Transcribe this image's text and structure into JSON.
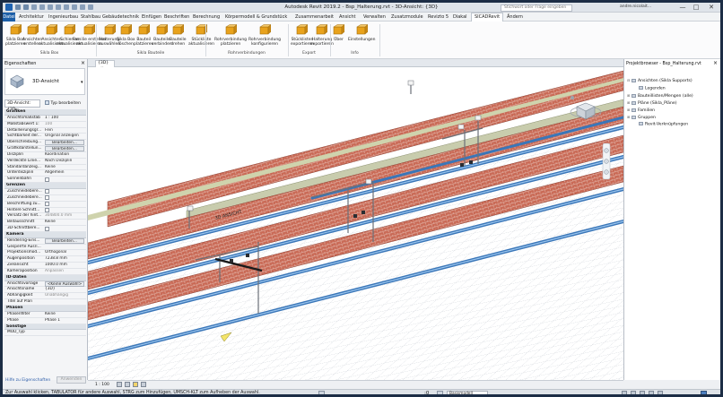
{
  "window": {
    "title": "Autodesk Revit 2019.2 - Bsp_Halterung.rvt - 3D-Ansicht: {3D}",
    "search_placeholder": "Stichwort oder Frage eingeben",
    "user": "andre.nicolait...",
    "minimize": "—",
    "maximize": "□",
    "close": "✕"
  },
  "menu": {
    "file": "Datei",
    "items": [
      "Architektur",
      "Ingenieurbau",
      "Stahlbau",
      "Gebäudetechnik",
      "Einfügen",
      "Beschriften",
      "Berechnung",
      "Körpermodell & Grundstück",
      "Zusammenarbeit",
      "Ansicht",
      "Verwalten",
      "Zusatzmodule",
      "Revizto 5",
      "Diakal",
      "SICADRevit",
      "Ändern"
    ],
    "active": "SICADRevit"
  },
  "ribbon": {
    "buttons": [
      {
        "label": "Sikla Box\nplatzieren",
        "icon": "sikla-box-place-icon",
        "color": "#e8a21c"
      },
      {
        "label": "Ansichten\nerstellen",
        "icon": "views-create-icon",
        "color": "#e8a21c"
      },
      {
        "label": "Ansichten\naktualisieren",
        "icon": "views-update-icon",
        "color": "#e8a21c"
      },
      {
        "label": "Schienen\naktualisieren",
        "icon": "rails-update-icon",
        "color": "#e8a21c"
      },
      {
        "label": "Familie erstellen\naktualisieren",
        "icon": "family-create-icon",
        "color": "#e8a21c"
      },
      {
        "label": "Halterung\nauswählen",
        "icon": "support-select-icon",
        "color": "#e8a21c"
      },
      {
        "label": "Sikla Box\nlöschen",
        "icon": "sikla-box-delete-icon",
        "color": "#e8a21c"
      },
      {
        "label": "Bauteil\nplatzieren",
        "icon": "component-place-icon",
        "color": "#e8a21c"
      },
      {
        "label": "Bauteile\nverbinden",
        "icon": "components-connect-icon",
        "color": "#e8a21c"
      },
      {
        "label": "Bauteile\ndrehen",
        "icon": "components-rotate-icon",
        "color": "#e8a21c"
      },
      {
        "label": "Stückliste\naktualisieren",
        "icon": "bom-update-icon",
        "color": "#e8a21c"
      },
      {
        "label": "Rohrverbindung\nplatzieren",
        "icon": "pipe-connection-place-icon",
        "color": "#e8a21c"
      },
      {
        "label": "Rohrverbindung\nkonfigurieren",
        "icon": "pipe-connection-config-icon",
        "color": "#e8a21c"
      },
      {
        "label": "Stücklisten\nexportieren",
        "icon": "bom-export-icon",
        "color": "#e8a21c"
      },
      {
        "label": "Halterung\nexportieren",
        "icon": "support-export-icon",
        "color": "#e8a21c"
      },
      {
        "label": "Über",
        "icon": "info-icon",
        "color": "#e8a21c"
      },
      {
        "label": "Einstellungen",
        "icon": "settings-icon",
        "color": "#e8a21c"
      }
    ],
    "groups": [
      "Sikla Box",
      "Sikla Bauteile",
      "Rohrverbindungen",
      "Export",
      "Info"
    ]
  },
  "properties": {
    "title": "Eigenschaften",
    "type_name": "3D-Ansicht",
    "filter": "3D-Ansicht: {3D",
    "edit_type": "Typ bearbeiten",
    "sections": [
      {
        "name": "Grafiken",
        "rows": [
          {
            "n": "Ansichtsmaßstab",
            "v": "1 : 100",
            "k": "text"
          },
          {
            "n": "Maßstabswert 1:",
            "v": "100",
            "k": "grey"
          },
          {
            "n": "Detaillierungsgr...",
            "v": "Fein",
            "k": "text"
          },
          {
            "n": "Sichtbarkeit der...",
            "v": "Original anzeigen",
            "k": "text"
          },
          {
            "n": "Überschreibung...",
            "v": "Bearbeiten...",
            "k": "btn"
          },
          {
            "n": "Grafikdarstellun...",
            "v": "Bearbeiten...",
            "k": "btn"
          },
          {
            "n": "Disziplin",
            "v": "Koordination",
            "k": "text"
          },
          {
            "n": "Verdeckte Linie...",
            "v": "Nach Disziplin",
            "k": "text"
          },
          {
            "n": "Standardanzeig...",
            "v": "Keine",
            "k": "text"
          },
          {
            "n": "Unterdisziplin",
            "v": "Allgemein",
            "k": "text"
          },
          {
            "n": "Sonnenbahn",
            "v": "",
            "k": "cb"
          }
        ]
      },
      {
        "name": "Grenzen",
        "rows": [
          {
            "n": "Zuschneidebere...",
            "v": "",
            "k": "cb"
          },
          {
            "n": "Zuschneidebere...",
            "v": "",
            "k": "cb"
          },
          {
            "n": "Beschriftung zu...",
            "v": "",
            "k": "cb"
          },
          {
            "n": "Hintere Schnitt...",
            "v": "",
            "k": "cb"
          },
          {
            "n": "Versatz der hint...",
            "v": "304800.0 mm",
            "k": "grey"
          },
          {
            "n": "Bildausschnitt",
            "v": "Keine",
            "k": "text"
          },
          {
            "n": "3D-Schnittbere...",
            "v": "",
            "k": "cb"
          }
        ]
      },
      {
        "name": "Kamera",
        "rows": [
          {
            "n": "Rendering-Eins...",
            "v": "Bearbeiten...",
            "k": "btn"
          },
          {
            "n": "Gesperrte Ausri...",
            "v": "",
            "k": "text"
          },
          {
            "n": "Projektionsmod...",
            "v": "Orthogonal",
            "k": "text"
          },
          {
            "n": "Augenposition",
            "v": "7238.8 mm",
            "k": "text"
          },
          {
            "n": "Zielansicht",
            "v": "1000.0 mm",
            "k": "text"
          },
          {
            "n": "Kameraposition",
            "v": "Anpassen",
            "k": "grey"
          }
        ]
      },
      {
        "name": "ID-Daten",
        "rows": [
          {
            "n": "Ansichtsvorlage",
            "v": "<Keine Auswahl>",
            "k": "btn"
          },
          {
            "n": "Ansichtsname",
            "v": "{3D}",
            "k": "text"
          },
          {
            "n": "Abhängigkeit",
            "v": "Unabhängig",
            "k": "grey"
          },
          {
            "n": "Titel auf Plan",
            "v": "",
            "k": "text"
          }
        ]
      },
      {
        "name": "Phasen",
        "rows": [
          {
            "n": "Phasenfilter",
            "v": "Keine",
            "k": "text"
          },
          {
            "n": "Phase",
            "v": "Phase 1",
            "k": "text"
          }
        ]
      },
      {
        "name": "Sonstige",
        "rows": [
          {
            "n": "MOD_Typ",
            "v": "",
            "k": "text"
          }
        ]
      }
    ],
    "help_link": "Hilfe zu Eigenschaften",
    "apply": "Anwenden"
  },
  "view": {
    "tab": "{3D}",
    "annotation": "3D ANSICHT",
    "scale": "1 : 100"
  },
  "browser": {
    "title": "Projektbrowser - Bsp_Halterung.rvt",
    "items": [
      {
        "label": "Ansichten (Sikla Supports)",
        "level": 0,
        "twisty": "⊟"
      },
      {
        "label": "Legenden",
        "level": 1,
        "twisty": ""
      },
      {
        "label": "Bauteillisten/Mengen (alle)",
        "level": 0,
        "twisty": "⊞"
      },
      {
        "label": "Pläne (Sikla_Pläne)",
        "level": 0,
        "twisty": "⊞"
      },
      {
        "label": "Familien",
        "level": 0,
        "twisty": "⊞"
      },
      {
        "label": "Gruppen",
        "level": 0,
        "twisty": "⊞"
      },
      {
        "label": "Revit-Verknüpfungen",
        "level": 1,
        "twisty": ""
      }
    ]
  },
  "status": {
    "text": "Zur Auswahl klicken, TABULATOR für andere Auswahl, STRG zum Hinzufügen, UMSCH-KLT zum Aufheben der Auswahl.",
    "model": "Basismodell",
    "coord": ":0"
  }
}
